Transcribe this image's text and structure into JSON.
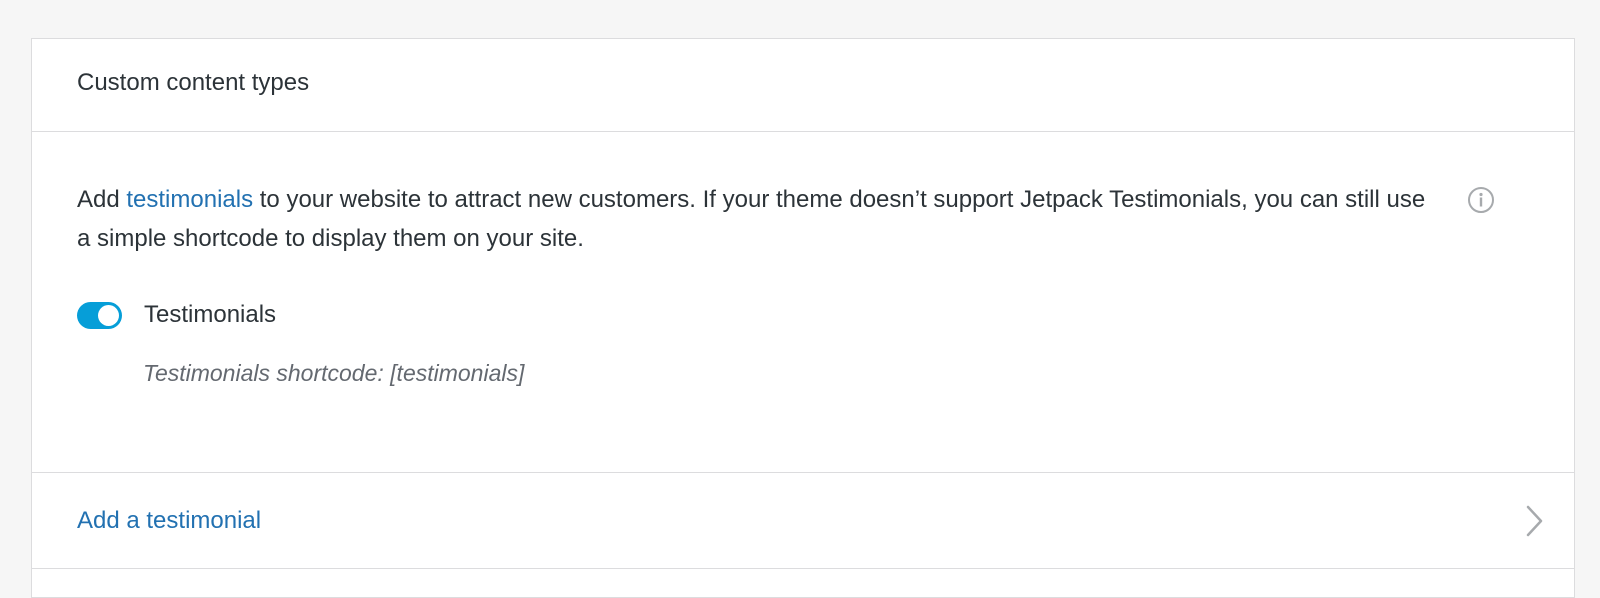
{
  "card": {
    "title": "Custom content types",
    "description_prefix": "Add ",
    "description_link": "testimonials",
    "description_suffix": " to your website to attract new customers. If your theme doesn’t support Jetpack Testimonials, you can still use a simple shortcode to display them on your site.",
    "info_icon": "info-icon",
    "toggle": {
      "label": "Testimonials",
      "state": "on",
      "color": "#069ed8"
    },
    "shortcode_note": "Testimonials shortcode: [testimonials]",
    "action": {
      "label": "Add a testimonial",
      "icon": "chevron-right-icon"
    }
  },
  "colors": {
    "link": "#2271b1",
    "text": "#2c3338",
    "muted": "#646970",
    "background": "#f6f6f6"
  }
}
